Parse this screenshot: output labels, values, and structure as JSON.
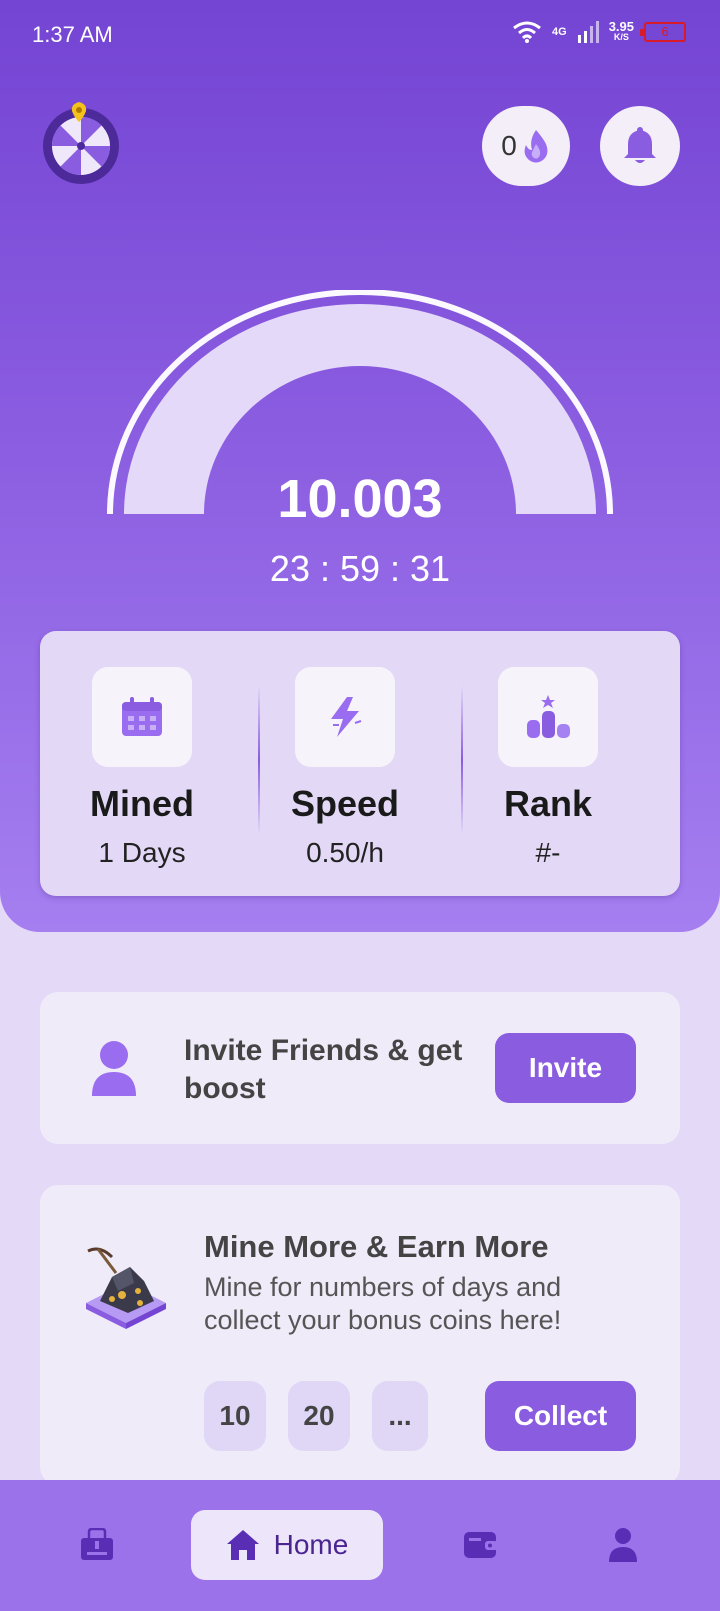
{
  "status_bar": {
    "time": "1:37 AM",
    "network_type": "4G",
    "net_speed_value": "3.95",
    "net_speed_unit": "K/S",
    "battery": "6"
  },
  "header": {
    "streak_count": "0",
    "icons": {
      "left": "spin-wheel-icon",
      "streak": "flame-icon",
      "notifications": "bell-icon"
    }
  },
  "miner": {
    "balance": "10.003",
    "countdown": "23 : 59 : 31"
  },
  "stats": [
    {
      "title": "Mined",
      "value": "1 Days",
      "icon": "calendar-icon"
    },
    {
      "title": "Speed",
      "value": "0.50/h",
      "icon": "lightning-icon"
    },
    {
      "title": "Rank",
      "value": "#-",
      "icon": "coin-stack-icon"
    }
  ],
  "invite": {
    "text": "Invite Friends & get boost",
    "button_label": "Invite"
  },
  "mine_more": {
    "title": "Mine More & Earn More",
    "description": "Mine for numbers of days and collect your bonus coins here!",
    "day_options": [
      "10",
      "20",
      "..."
    ],
    "button_label": "Collect"
  },
  "bottom_nav": {
    "home_label": "Home",
    "items": [
      "shop-icon",
      "home-icon",
      "wallet-icon",
      "profile-icon"
    ]
  },
  "colors": {
    "primary": "#8a5ce0",
    "hero_top": "#7444d3",
    "background": "#e4daf8",
    "card": "#efebf9"
  }
}
